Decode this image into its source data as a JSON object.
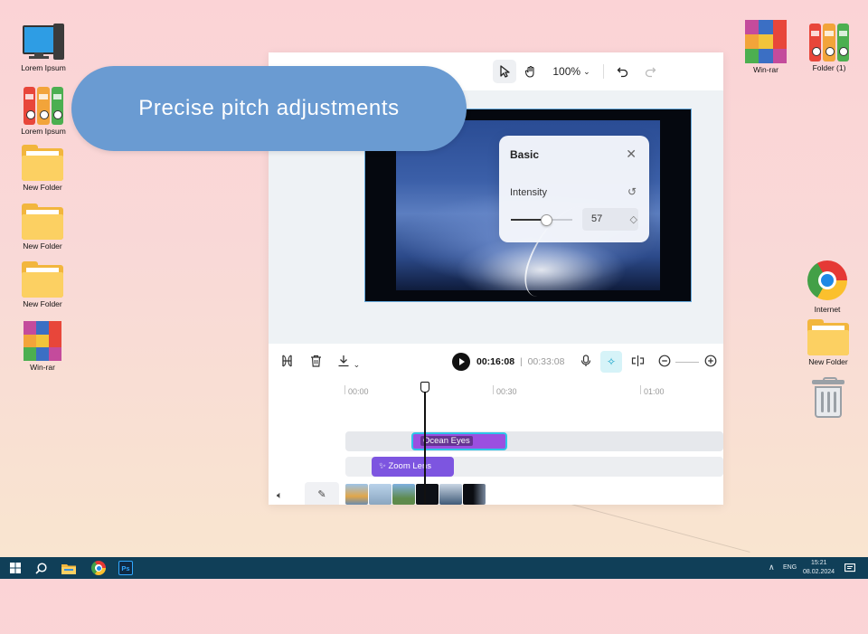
{
  "desktop": {
    "left_icons": [
      {
        "label": "Lorem Ipsum",
        "icon": "computer-icon"
      },
      {
        "label": "Lorem Ipsum",
        "icon": "binders-icon"
      },
      {
        "label": "New Folder",
        "icon": "folder-icon"
      },
      {
        "label": "New Folder",
        "icon": "folder-icon"
      },
      {
        "label": "New Folder",
        "icon": "folder-icon"
      },
      {
        "label": "Win-rar",
        "icon": "winrar-icon"
      }
    ],
    "right_icons": [
      {
        "label": "Win-rar",
        "icon": "winrar-icon"
      },
      {
        "label": "Folder (1)",
        "icon": "binders-icon"
      },
      {
        "label": "Internet",
        "icon": "chrome-icon"
      },
      {
        "label": "New Folder",
        "icon": "folder-icon"
      },
      {
        "label": "",
        "icon": "recycle-bin-icon"
      }
    ]
  },
  "overlay": {
    "caption": "Precise pitch adjustments"
  },
  "editor": {
    "topbar": {
      "zoom_level": "100%"
    },
    "basic_panel": {
      "title": "Basic",
      "intensity_label": "Intensity",
      "intensity_value": "57",
      "intensity_fraction": 0.57
    },
    "playback": {
      "current_time": "00:16:08",
      "separator": "|",
      "total_time": "00:33:08"
    },
    "ruler_labels": [
      "00:00",
      "00:30",
      "01:00"
    ],
    "clips": {
      "ocean_eyes": "Ocean Eyes",
      "zoom_lens": "Zoom Lens"
    }
  },
  "taskbar": {
    "language": "ENG",
    "time": "15:21",
    "date": "08.02.2024",
    "apps": [
      "windows-icon",
      "search-icon",
      "file-explorer-icon",
      "chrome-icon",
      "photoshop-icon"
    ],
    "photoshop_label": "Ps"
  },
  "colors": {
    "caption_pill": "#6a9bd2",
    "taskbar": "#103f58",
    "ocean_clip": "#9b4fe0",
    "zoom_clip": "#7d55e0",
    "selected_clip_border": "#2ec4e8"
  }
}
